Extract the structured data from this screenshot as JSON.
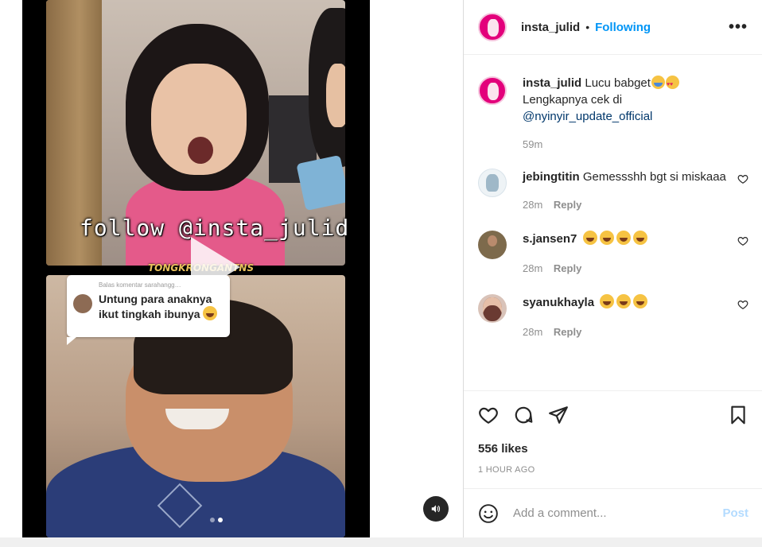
{
  "post": {
    "username": "insta_julid",
    "separator": "•",
    "follow_status": "Following",
    "more_label": "•••"
  },
  "media": {
    "overlay_text": "follow @insta_julid",
    "watermark": "TONGKRONGANTNS",
    "reply_header": "Balas komentar sarahangg…",
    "reply_text": "Untung para anaknya ikut tingkah ibunya",
    "carousel_index": 2,
    "carousel_total": 2
  },
  "caption": {
    "username": "insta_julid",
    "text_1": "Lucu babget",
    "text_2": "Lengkapnya cek di",
    "mention": "@nyinyir_update_official",
    "time": "59m"
  },
  "comments": [
    {
      "username": "jebingtitin",
      "text": "Gemessshh bgt si miskaaa",
      "time": "28m",
      "reply_label": "Reply"
    },
    {
      "username": "s.jansen7",
      "text": "",
      "emoji_count": 4,
      "time": "28m",
      "reply_label": "Reply"
    },
    {
      "username": "syanukhayla",
      "text": "",
      "emoji_count": 3,
      "time": "28m",
      "reply_label": "Reply"
    }
  ],
  "actions": {
    "likes": "556 likes",
    "posted": "1 HOUR AGO"
  },
  "add_comment": {
    "placeholder": "Add a comment...",
    "post_label": "Post"
  },
  "colors": {
    "accent": "#0095f6",
    "mention": "#00376b",
    "muted": "#8e8e8e",
    "post_disabled": "#b3dbff"
  }
}
